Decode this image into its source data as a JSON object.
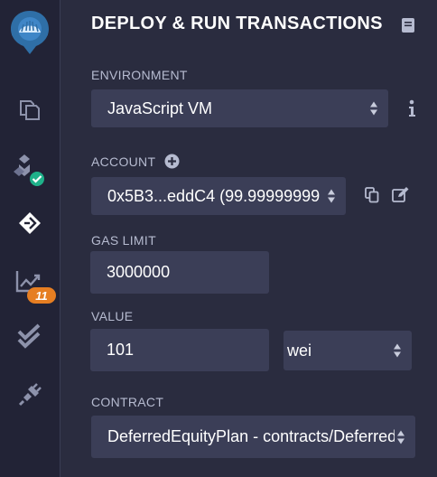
{
  "panel": {
    "title": "DEPLOY & RUN TRANSACTIONS"
  },
  "iconbar": {
    "items": [
      {
        "name": "remix-logo-icon"
      },
      {
        "name": "file-explorer-icon"
      },
      {
        "name": "compiler-icon",
        "status": "success"
      },
      {
        "name": "deploy-run-icon",
        "active": true
      },
      {
        "name": "analysis-icon",
        "badge": "11"
      },
      {
        "name": "testing-icon"
      },
      {
        "name": "plugin-manager-icon"
      }
    ]
  },
  "environment": {
    "label": "ENVIRONMENT",
    "value": "JavaScript VM"
  },
  "account": {
    "label": "ACCOUNT",
    "value": "0x5B3...eddC4 (99.99999999"
  },
  "gas_limit": {
    "label": "GAS LIMIT",
    "value": "3000000"
  },
  "value": {
    "label": "VALUE",
    "amount": "101",
    "unit": "wei"
  },
  "contract": {
    "label": "CONTRACT",
    "value": "DeferredEquityPlan - contracts/DeferredEquityPlan.sol"
  },
  "colors": {
    "background": "#2a2c3f",
    "iconbar": "#222336",
    "input": "#3b3e57",
    "accent_blue": "#2f6fa7",
    "success_green": "#1fb18a",
    "badge_orange": "#e67e22"
  }
}
